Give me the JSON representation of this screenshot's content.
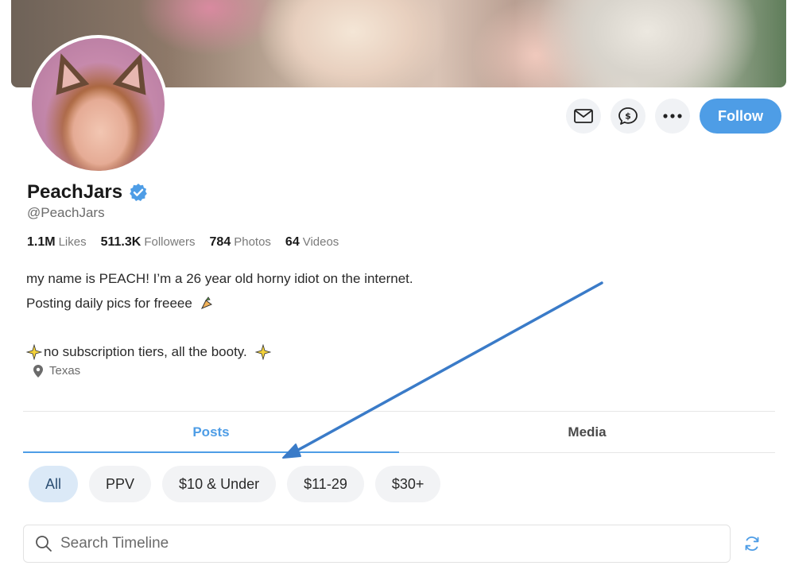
{
  "profile": {
    "display_name": "PeachJars",
    "handle": "@PeachJars",
    "verified": true,
    "follow_label": "Follow"
  },
  "stats": [
    {
      "value": "1.1M",
      "label": "Likes"
    },
    {
      "value": "511.3K",
      "label": "Followers"
    },
    {
      "value": "784",
      "label": "Photos"
    },
    {
      "value": "64",
      "label": "Videos"
    }
  ],
  "bio": {
    "line1": "my name is PEACH! I’m a 26 year old horny idiot on the internet.",
    "line2": "Posting daily pics for freeee",
    "line3": "no subscription tiers, all the booty."
  },
  "location": "Texas",
  "tabs": [
    {
      "label": "Posts",
      "active": true
    },
    {
      "label": "Media",
      "active": false
    }
  ],
  "filters": [
    {
      "label": "All",
      "active": true
    },
    {
      "label": "PPV",
      "active": false
    },
    {
      "label": "$10 & Under",
      "active": false
    },
    {
      "label": "$11-29",
      "active": false
    },
    {
      "label": "$30+",
      "active": false
    }
  ],
  "search": {
    "placeholder": "Search Timeline"
  },
  "icons": {
    "message": "envelope-icon",
    "tip": "dollar-speech-bubble-icon",
    "more": "ellipsis-icon",
    "verified": "verified-badge-icon",
    "location": "map-pin-icon",
    "search": "search-icon",
    "refresh": "refresh-icon"
  },
  "colors": {
    "accent": "#4e9de6",
    "annotation_arrow": "#3a7bc8"
  }
}
